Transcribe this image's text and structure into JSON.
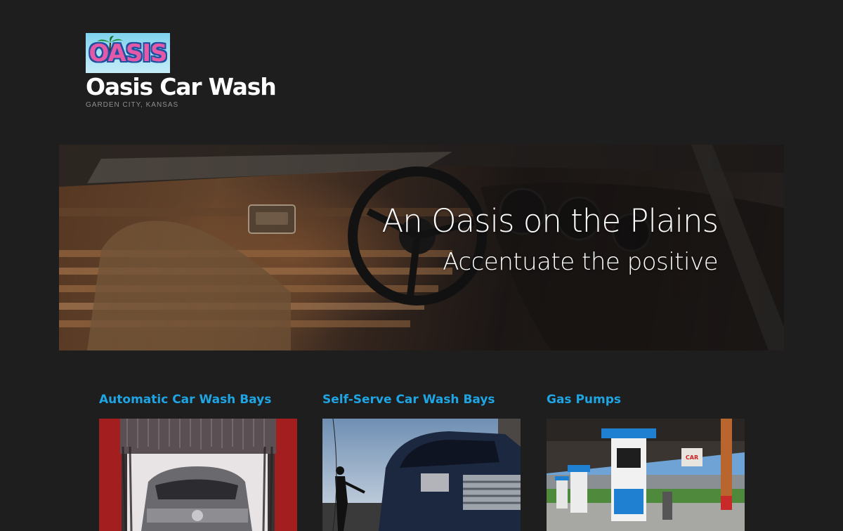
{
  "header": {
    "logo_text": "OASIS",
    "site_title": "Oasis Car Wash",
    "tagline": "GARDEN CITY, KANSAS"
  },
  "hero": {
    "heading": "An Oasis on the Plains",
    "subheading": "Accentuate the positive"
  },
  "services": [
    {
      "title": "Automatic Car Wash Bays"
    },
    {
      "title": "Self-Serve Car Wash Bays"
    },
    {
      "title": "Gas Pumps"
    }
  ],
  "colors": {
    "background": "#1e1e1e",
    "link_accent": "#1fa5e3",
    "logo_pink": "#e55aa6",
    "logo_blue": "#1f4fa0"
  }
}
